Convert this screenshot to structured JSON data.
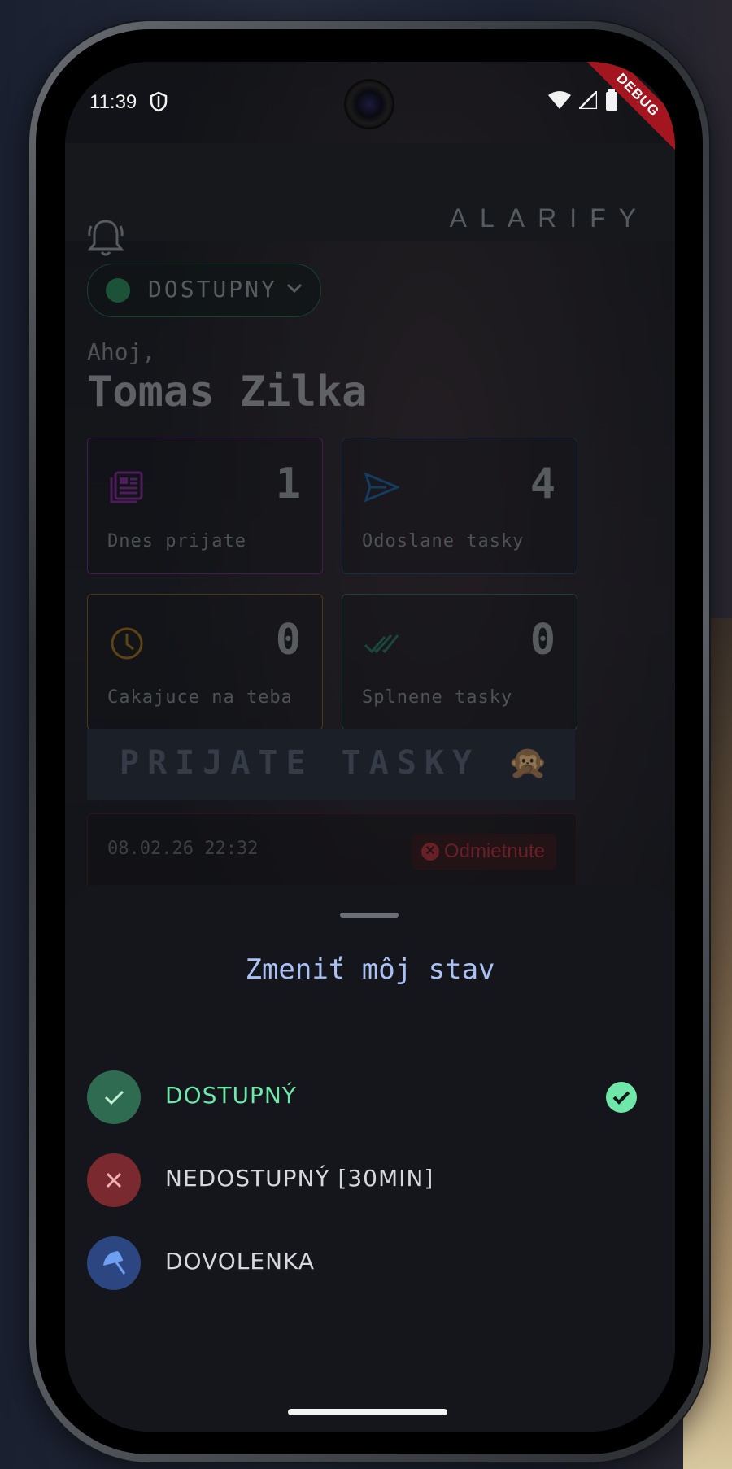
{
  "status_bar": {
    "time": "11:39",
    "icons": [
      "shield-icon",
      "wifi-icon",
      "signal-icon",
      "battery-icon"
    ]
  },
  "debug_banner": "DEBUG",
  "app_bar": {
    "title": "ALARIFY",
    "left_icon": "bell-icon"
  },
  "availability_pill": {
    "label": "DOSTUPNY",
    "dot_color": "#2e8f5e"
  },
  "greeting": {
    "hello": "Ahoj,",
    "name": "Tomas Zilka"
  },
  "stats": [
    {
      "label": "Dnes prijate",
      "value": "1",
      "icon": "newspaper-icon",
      "color": "#8b2fa0"
    },
    {
      "label": "Odoslane tasky",
      "value": "4",
      "icon": "send-icon",
      "color": "#1f5f9a"
    },
    {
      "label": "Cakajuce na teba",
      "value": "0",
      "icon": "clock-icon",
      "color": "#a8711a"
    },
    {
      "label": "Splnene tasky",
      "value": "0",
      "icon": "double-check-icon",
      "color": "#2b7a63"
    }
  ],
  "section": {
    "title": "PRIJATE TASKY",
    "emoji": "🙊"
  },
  "task": {
    "date": "08.02.26 22:32",
    "status": "Odmietnute"
  },
  "sheet": {
    "title": "Zmeniť môj stav",
    "options": [
      {
        "label": "DOSTUPNÝ",
        "icon": "check-icon",
        "color": "#2f6b50",
        "label_color": "#6ee7a9",
        "selected": true
      },
      {
        "label": "NEDOSTUPNÝ [30MIN]",
        "icon": "close-icon",
        "color": "#7a2a2e",
        "label_color": "#d6d8dc",
        "selected": false
      },
      {
        "label": "DOVOLENKA",
        "icon": "umbrella-icon",
        "color": "#2b4680",
        "label_color": "#d6d8dc",
        "selected": false
      }
    ]
  }
}
